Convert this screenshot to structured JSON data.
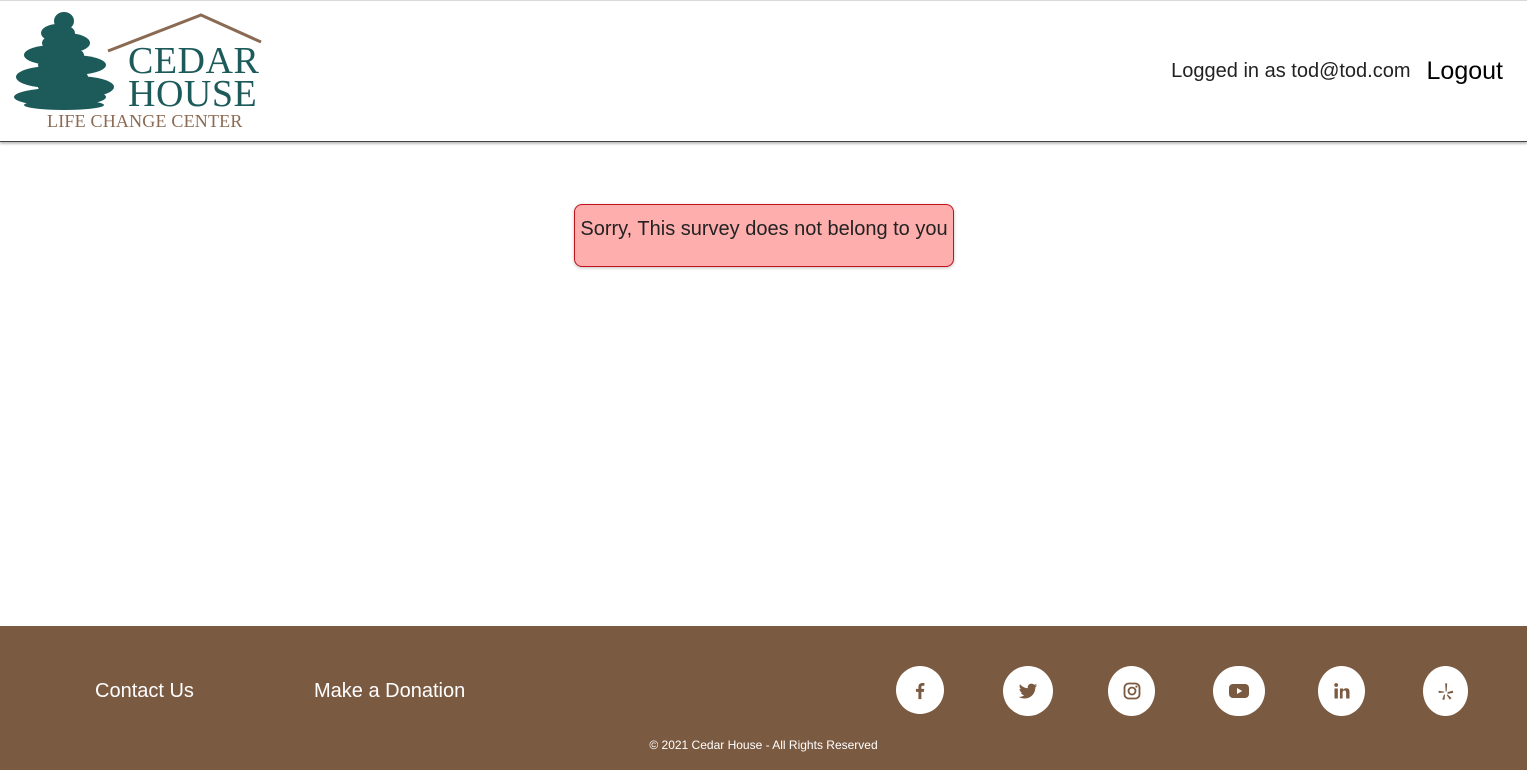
{
  "header": {
    "logo": {
      "line1": "CEDAR",
      "line2": "HOUSE",
      "line3": "LIFE CHANGE CENTER"
    },
    "logged_in_text": "Logged in as tod@tod.com",
    "logout_label": "Logout"
  },
  "alert": {
    "message": "Sorry, This survey does not belong to you"
  },
  "footer": {
    "contact_label": "Contact Us",
    "donate_label": "Make a Donation",
    "social_icons": [
      "facebook-icon",
      "twitter-icon",
      "instagram-icon",
      "youtube-icon",
      "linkedin-icon",
      "yelp-icon"
    ],
    "copyright": "© 2021 Cedar House - All Rights Reserved"
  },
  "colors": {
    "brand_teal": "#1d5a5a",
    "brand_brown": "#7b5a42",
    "alert_background": "#ffaeae",
    "alert_border": "#c0121b"
  }
}
